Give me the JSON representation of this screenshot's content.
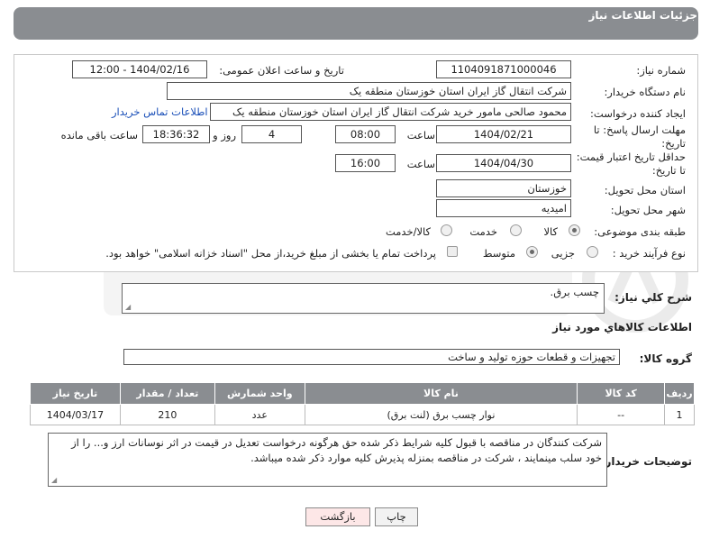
{
  "header": {
    "title": "جزئیات اطلاعات نیاز"
  },
  "form": {
    "need_number_label": "شماره نیاز:",
    "need_number": "1104091871000046",
    "announce_label": "تاریخ و ساعت اعلان عمومی:",
    "announce_value": "1404/02/16 - 12:00",
    "buyer_org_label": "نام دستگاه خریدار:",
    "buyer_org": "شرکت انتقال گاز ایران  استان خوزستان منطقه یک",
    "creator_label": "ایجاد کننده درخواست:",
    "creator": "محمود صالحی مامور خرید شرکت انتقال گاز ایران  استان خوزستان منطقه یک",
    "buyer_contact_link": "اطلاعات تماس خریدار",
    "deadline_label": "مهلت ارسال پاسخ: تا تاریخ:",
    "deadline_date": "1404/02/21",
    "time_label": "ساعت",
    "deadline_time": "08:00",
    "days_value": "4",
    "days_label": "روز و",
    "remaining_time": "18:36:32",
    "remaining_label": "ساعت باقی مانده",
    "price_validity_label": "حداقل تاریخ اعتبار قیمت: تا تاریخ:",
    "price_validity_date": "1404/04/30",
    "price_validity_time": "16:00",
    "delivery_province_label": "استان محل تحویل:",
    "delivery_province": "خوزستان",
    "delivery_city_label": "شهر محل تحویل:",
    "delivery_city": "امیدیه",
    "category_label": "طبقه بندی موضوعی:",
    "category_options": [
      "کالا",
      "خدمت",
      "کالا/خدمت"
    ],
    "process_label": "نوع فرآیند خرید :",
    "process_options": [
      "جزیی",
      "متوسط"
    ],
    "payment_note": "پرداخت تمام یا بخشی از مبلغ خرید،از محل \"اسناد خزانه اسلامی\" خواهد بود.",
    "description_label": "شرح کلي نياز:",
    "description": "چسب برق."
  },
  "goods": {
    "section_title": "اطلاعات كالاهاي مورد نياز",
    "group_label": "گروه کالا:",
    "group_value": "تجهیزات و قطعات حوزه تولید و ساخت"
  },
  "table": {
    "headers": [
      "ردیف",
      "کد کالا",
      "نام کالا",
      "واحد شمارش",
      "تعداد / مقدار",
      "تاریخ نیاز"
    ],
    "rows": [
      [
        "1",
        "--",
        "نوار چسب برق (لنت برق)",
        "عدد",
        "210",
        "1404/03/17"
      ]
    ]
  },
  "buyer_notes": {
    "label": "توضیحات خریدار:",
    "text": "شرکت کنندگان در مناقصه با قبول کلیه شرایط ذکر شده حق هرگونه درخواست تعدیل در قیمت در اثر نوسانات ارز و... را از خود سلب مینمایند ، شرکت در مناقصه بمنزله پذیرش کلیه موارد ذکر شده میباشد."
  },
  "buttons": {
    "print": "چاپ",
    "back": "بازگشت"
  },
  "colors": {
    "header_bg": "#8a8d91",
    "link": "#1a4fb8",
    "back_button_bg": "#fde7e7"
  }
}
